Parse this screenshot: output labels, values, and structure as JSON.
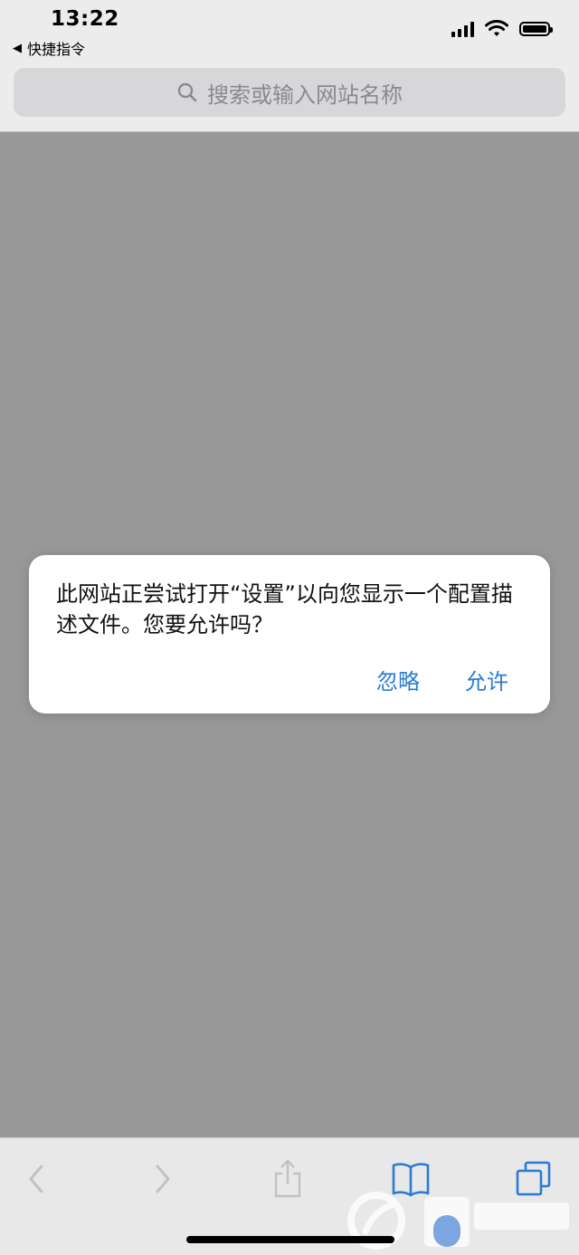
{
  "status_bar": {
    "time": "13:22",
    "back_label": "快捷指令"
  },
  "search": {
    "placeholder": "搜索或输入网站名称"
  },
  "dialog": {
    "message": "此网站正尝试打开“设置”以向您显示一个配置描述文件。您要允许吗？",
    "ignore_label": "忽略",
    "allow_label": "允许",
    "accent_color": "#2b7bd5"
  },
  "toolbar": {
    "icons": [
      "back-icon",
      "forward-icon",
      "share-icon",
      "bookmarks-icon",
      "tabs-icon"
    ]
  }
}
